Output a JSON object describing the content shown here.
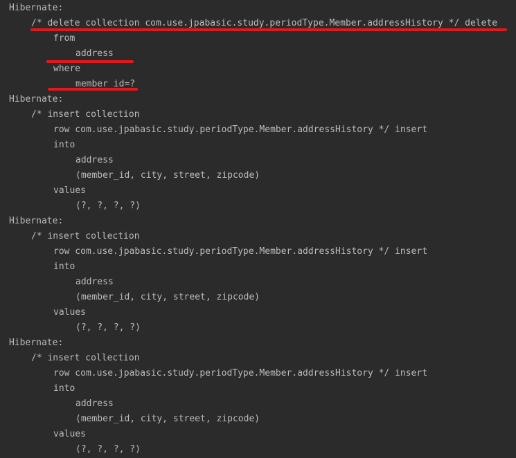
{
  "console": {
    "lines": [
      {
        "text": "Hibernate:"
      },
      {
        "text": "/* delete collection com.use.jpabasic.study.periodType.Member.addressHistory */ delete"
      },
      {
        "text": "from"
      },
      {
        "text": "address"
      },
      {
        "text": "where"
      },
      {
        "text": "member_id=?"
      },
      {
        "text": "Hibernate:"
      },
      {
        "text": "/* insert collection"
      },
      {
        "text": "row com.use.jpabasic.study.periodType.Member.addressHistory */ insert"
      },
      {
        "text": "into"
      },
      {
        "text": "address"
      },
      {
        "text": "(member_id, city, street, zipcode)"
      },
      {
        "text": "values"
      },
      {
        "text": "(?, ?, ?, ?)"
      },
      {
        "text": "Hibernate:"
      },
      {
        "text": "/* insert collection"
      },
      {
        "text": "row com.use.jpabasic.study.periodType.Member.addressHistory */ insert"
      },
      {
        "text": "into"
      },
      {
        "text": "address"
      },
      {
        "text": "(member_id, city, street, zipcode)"
      },
      {
        "text": "values"
      },
      {
        "text": "(?, ?, ?, ?)"
      },
      {
        "text": "Hibernate:"
      },
      {
        "text": "/* insert collection"
      },
      {
        "text": "row com.use.jpabasic.study.periodType.Member.addressHistory */ insert"
      },
      {
        "text": "into"
      },
      {
        "text": "address"
      },
      {
        "text": "(member_id, city, street, zipcode)"
      },
      {
        "text": "values"
      },
      {
        "text": "(?, ?, ?, ?)"
      }
    ]
  }
}
